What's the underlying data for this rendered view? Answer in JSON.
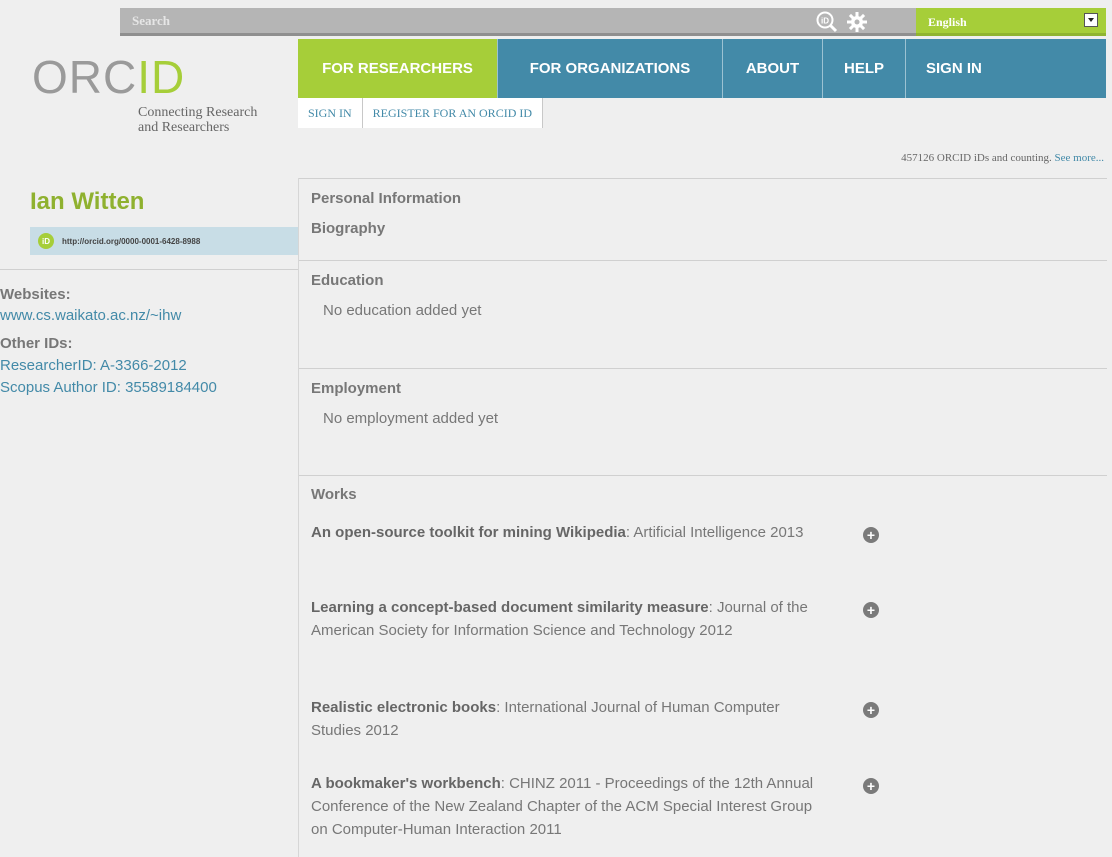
{
  "search": {
    "placeholder": "Search"
  },
  "language": {
    "selected": "English"
  },
  "logo": {
    "text_main": "ORC",
    "text_id": "ID",
    "tagline_line1": "Connecting Research",
    "tagline_line2": "and Researchers"
  },
  "nav": {
    "items": [
      "FOR RESEARCHERS",
      "FOR ORGANIZATIONS",
      "ABOUT",
      "HELP",
      "SIGN IN"
    ]
  },
  "subnav": {
    "items": [
      "SIGN IN",
      "REGISTER FOR AN ORCID ID"
    ]
  },
  "counter": {
    "text": "457126 ORCID iDs and counting.",
    "link": "See more..."
  },
  "profile": {
    "name": "Ian Witten",
    "orcid_badge": "iD",
    "orcid_url": "http://orcid.org/0000-0001-6428-8988",
    "websites_label": "Websites:",
    "website": "www.cs.waikato.ac.nz/~ihw",
    "other_ids_label": "Other IDs:",
    "researcher_id": "ResearcherID: A-3366-2012",
    "scopus_id": "Scopus Author ID: 35589184400"
  },
  "sections": {
    "personal_info": "Personal Information",
    "biography": "Biography",
    "education": "Education",
    "education_empty": "No education added yet",
    "employment": "Employment",
    "employment_empty": "No employment added yet",
    "works": "Works"
  },
  "works": [
    {
      "title": "An open-source toolkit for mining Wikipedia",
      "rest": ": Artificial Intelligence 2013"
    },
    {
      "title": "Learning a concept-based document similarity measure",
      "rest": ": Journal of the American Society for Information Science and Technology 2012"
    },
    {
      "title": "Realistic electronic books",
      "rest": ": International Journal of Human Computer Studies 2012"
    },
    {
      "title": "A bookmaker's workbench",
      "rest": ": CHINZ 2011 - Proceedings of the 12th Annual Conference of the New Zealand Chapter of the ACM Special Interest Group on Computer-Human Interaction 2011"
    }
  ],
  "icons": {
    "search": "orcid-search-icon",
    "settings": "gear-icon",
    "expand": "plus-circle-icon"
  },
  "colors": {
    "green": "#a6ce39",
    "blue": "#438aa8",
    "gray": "#777777"
  }
}
